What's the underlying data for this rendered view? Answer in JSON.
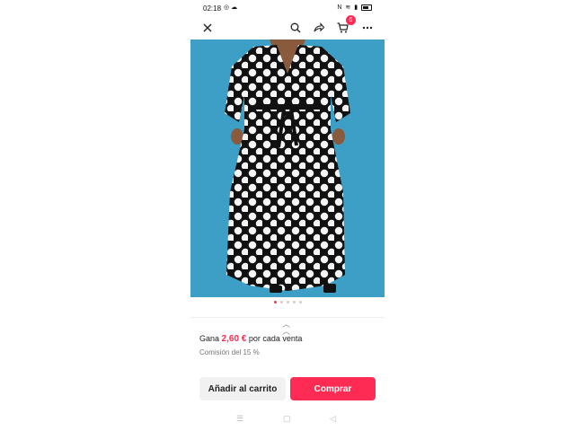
{
  "status_bar": {
    "time": "02:18",
    "left_icons": [
      "whatsapp-icon",
      "cloud-icon"
    ],
    "right_icons": [
      "nfc-icon",
      "wifi-icon",
      "signal-icon",
      "battery-icon"
    ]
  },
  "top_bar": {
    "icons": [
      "close-icon",
      "search-icon",
      "share-icon",
      "cart-icon",
      "more-icon"
    ],
    "cart_badge": "6"
  },
  "product_image": {
    "description_icon": "product-photo",
    "background_color": "#3d9fc6"
  },
  "carousel": {
    "total": 5,
    "active": 1
  },
  "commission": {
    "earn_prefix": "Gana",
    "earn_amount": "2,60 €",
    "earn_suffix": "por cada venta",
    "rate_text": "Comisión del 15 %"
  },
  "actions": {
    "add_to_cart_label": "Añadir al carrito",
    "buy_label": "Comprar"
  },
  "colors": {
    "accent": "#fe2c55"
  },
  "system_nav": [
    "menu-icon",
    "home-icon",
    "back-icon"
  ]
}
